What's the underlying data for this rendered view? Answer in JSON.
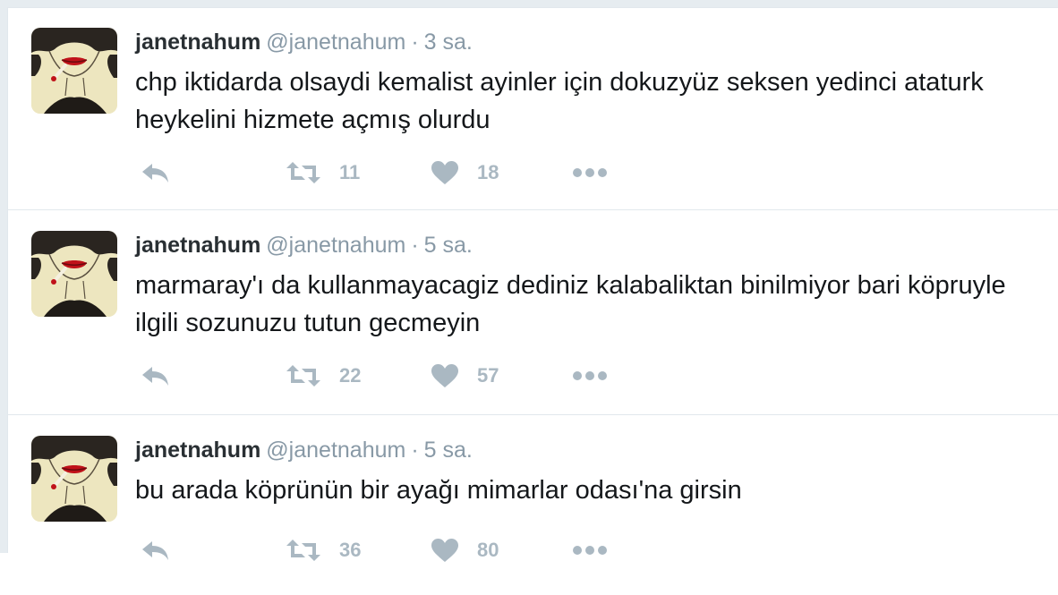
{
  "colors": {
    "name": "#292f33",
    "secondary": "#8899a6",
    "text": "#14171a",
    "action": "#aab8c2",
    "border": "#e1e8ed",
    "background": "#e6ecf0"
  },
  "tweets": [
    {
      "fullname": "janetnahum",
      "username": "@janetnahum",
      "separator": "·",
      "time": "3 sa.",
      "text": "chp iktidarda olsaydi kemalist ayinler için dokuzyüz seksen yedinci ataturk heykelini hizmete açmış olurdu",
      "retweets": "11",
      "likes": "18",
      "icons": [
        "reply-icon",
        "retweet-icon",
        "heart-icon",
        "more-icon"
      ]
    },
    {
      "fullname": "janetnahum",
      "username": "@janetnahum",
      "separator": "·",
      "time": "5 sa.",
      "text": "marmaray'ı da kullanmayacagiz dediniz kalabaliktan binilmiyor bari köpruyle ilgili sozunuzu tutun gecmeyin",
      "retweets": "22",
      "likes": "57",
      "icons": [
        "reply-icon",
        "retweet-icon",
        "heart-icon",
        "more-icon"
      ]
    },
    {
      "fullname": "janetnahum",
      "username": "@janetnahum",
      "separator": "·",
      "time": "5 sa.",
      "text": "bu arada köprünün bir ayağı mimarlar odası'na girsin",
      "retweets": "36",
      "likes": "80",
      "icons": [
        "reply-icon",
        "retweet-icon",
        "heart-icon",
        "more-icon"
      ]
    }
  ]
}
